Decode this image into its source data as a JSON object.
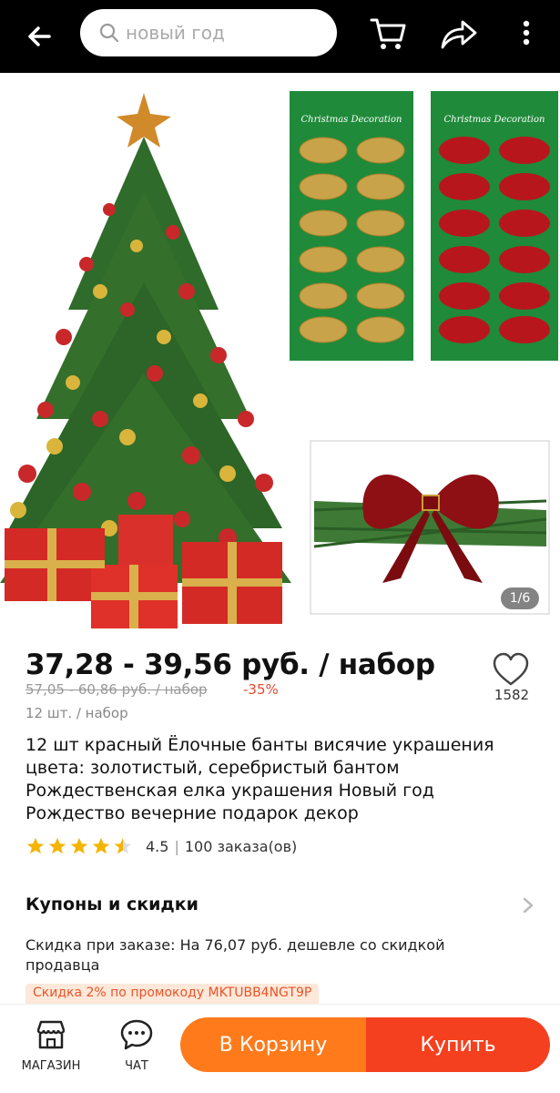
{
  "header": {
    "search_placeholder": "новый год"
  },
  "gallery": {
    "counter": "1/6",
    "tree_image": "christmas-tree-with-gifts",
    "card_gold_label": "Christmas Decoration",
    "card_red_label": "Christmas Decoration",
    "closeup_image": "red-bow-on-branch"
  },
  "product": {
    "price": "37,28 - 39,56 руб. / набор",
    "old_price": "57,05 - 60,86 руб. / набор",
    "discount": "-35%",
    "unit": "12 шт. / набор",
    "wishlist_count": "1582",
    "title": "12 шт красный Ёлочные банты висячие украшения цвета: золотистый, серебристый бантом Рождественская елка украшения Новый год Рождество вечерние подарок декор",
    "rating": "4.5",
    "rating_separator": "|",
    "orders": "100 заказа(ов)"
  },
  "coupons": {
    "title": "Купоны и скидки",
    "description": "Скидка при заказе: На 76,07 руб. дешевле со скидкой продавца",
    "promo": "Скидка 2% по промокоду MKTUBB4NGT9P"
  },
  "bottom_bar": {
    "store_label": "МАГАЗИН",
    "chat_label": "ЧАТ",
    "add_to_cart_label": "В Корзину",
    "buy_label": "Купить"
  },
  "colors": {
    "accent_orange": "#ff7a1a",
    "accent_red": "#f4401e",
    "star_gold": "#f5b400",
    "discount_red": "#e8452e"
  }
}
